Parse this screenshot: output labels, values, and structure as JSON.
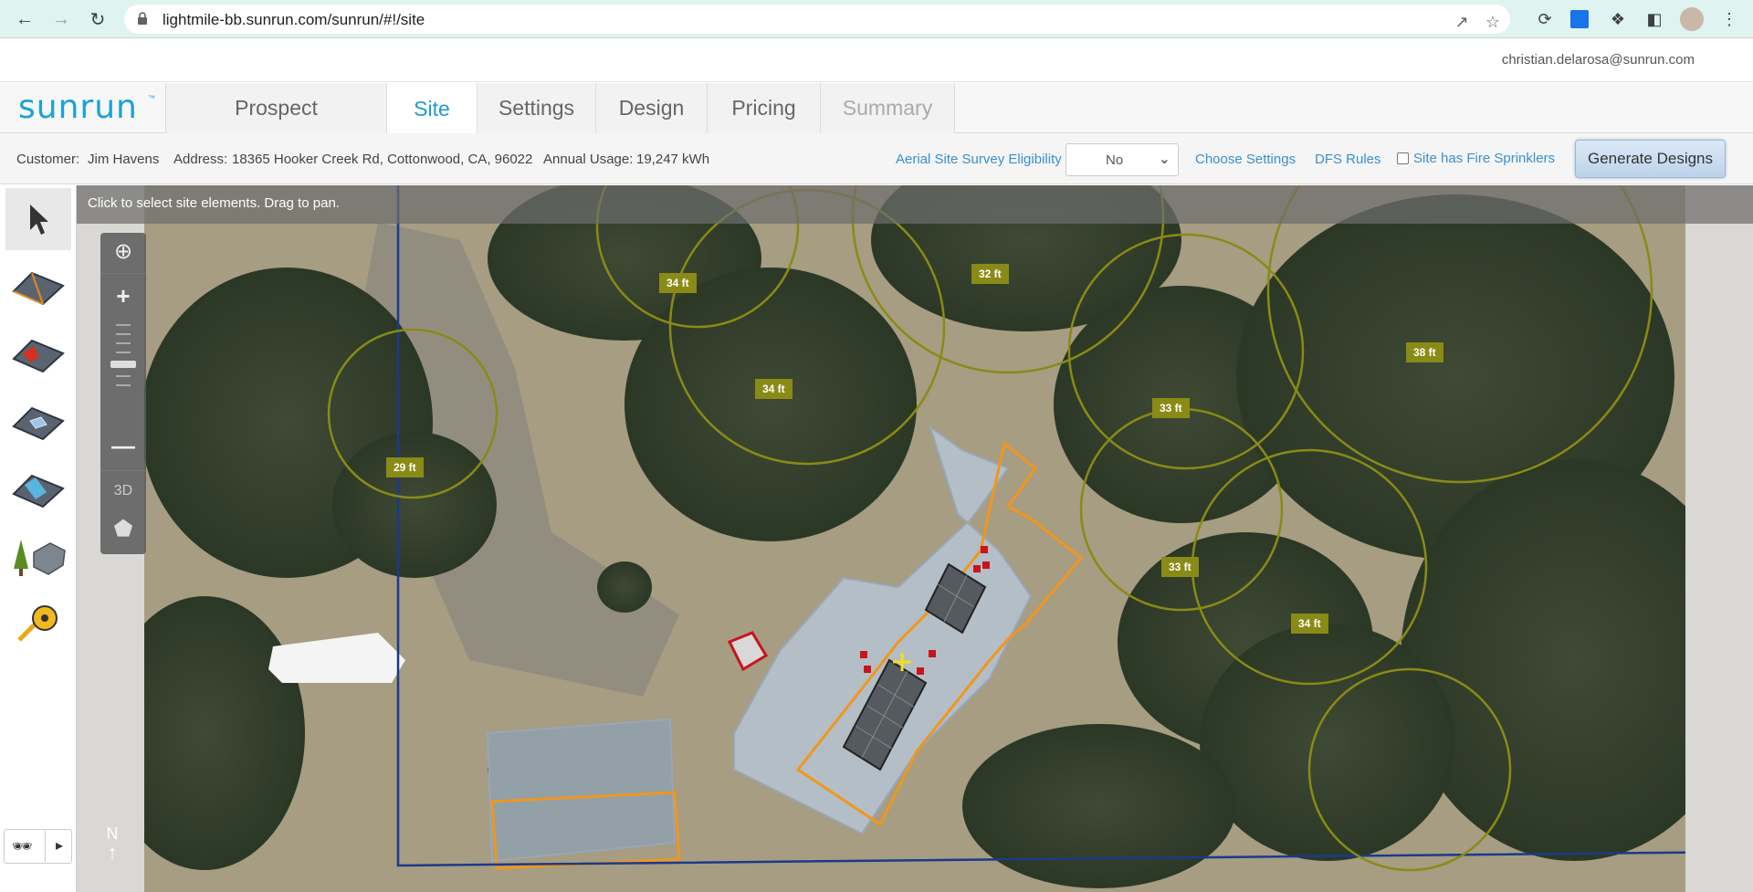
{
  "browser": {
    "url": "lightmile-bb.sunrun.com/sunrun/#!/site"
  },
  "user": {
    "email": "christian.delarosa@sunrun.com"
  },
  "app": {
    "logo": "sunrun",
    "tabs": [
      {
        "label": "Prospect",
        "state": "normal"
      },
      {
        "label": "Site",
        "state": "active"
      },
      {
        "label": "Settings",
        "state": "normal"
      },
      {
        "label": "Design",
        "state": "normal"
      },
      {
        "label": "Pricing",
        "state": "normal"
      },
      {
        "label": "Summary",
        "state": "disabled"
      }
    ]
  },
  "customer_bar": {
    "customer_label": "Customer:",
    "customer_name": "Jim Havens",
    "address_label": "Address:",
    "address": "18365 Hooker Creek Rd, Cottonwood, CA, 96022",
    "usage_label": "Annual Usage:",
    "usage": "19,247 kWh",
    "aerial_link": "Aerial Site Survey Eligibility",
    "aerial_value": "No",
    "choose_settings": "Choose Settings",
    "dfs_rules": "DFS Rules",
    "fire_sprinklers_label": "Site has Fire Sprinklers",
    "fire_sprinklers_checked": false,
    "generate_button": "Generate Designs"
  },
  "map": {
    "hint": "Click to select site elements. Drag to pan.",
    "view_3d": "3D",
    "north": "N",
    "tree_heights": [
      "34 ft",
      "32 ft",
      "38 ft",
      "34 ft",
      "33 ft",
      "29 ft",
      "33 ft",
      "34 ft"
    ]
  },
  "colors": {
    "accent": "#1e9ad6",
    "tree_circle": "#8a8a16",
    "roof_outline": "#f0961e",
    "property_line": "#1a3a8c"
  }
}
